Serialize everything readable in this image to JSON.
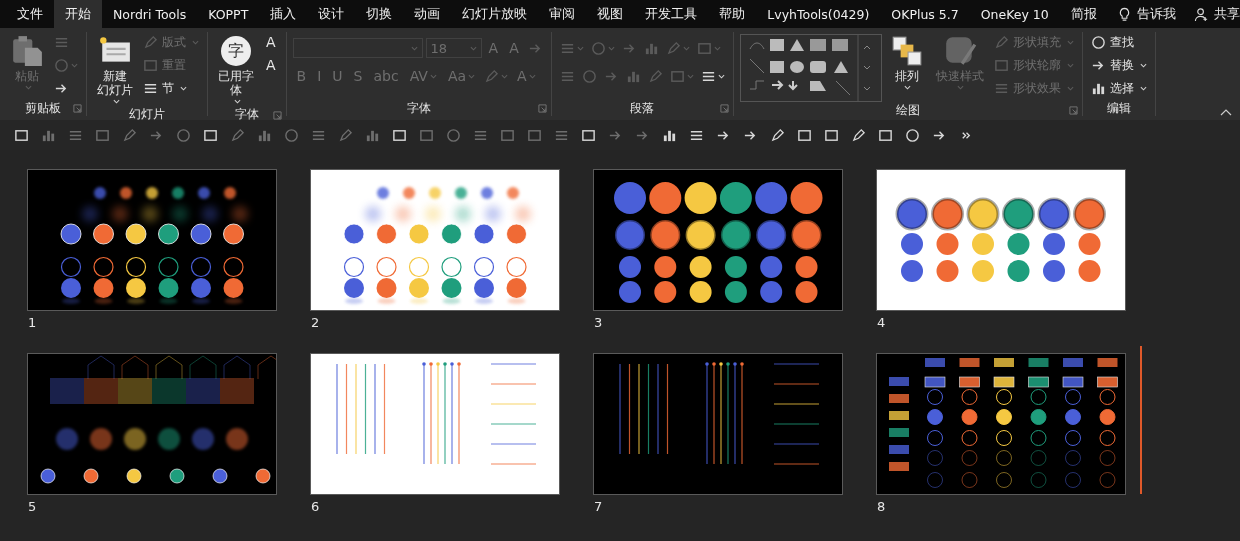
{
  "tabs": [
    {
      "label": "文件",
      "selected": false
    },
    {
      "label": "开始",
      "selected": true
    },
    {
      "label": "Nordri Tools",
      "selected": false
    },
    {
      "label": "KOPPT",
      "selected": false
    },
    {
      "label": "插入",
      "selected": false
    },
    {
      "label": "设计",
      "selected": false
    },
    {
      "label": "切换",
      "selected": false
    },
    {
      "label": "动画",
      "selected": false
    },
    {
      "label": "幻灯片放映",
      "selected": false
    },
    {
      "label": "审阅",
      "selected": false
    },
    {
      "label": "视图",
      "selected": false
    },
    {
      "label": "开发工具",
      "selected": false
    },
    {
      "label": "帮助",
      "selected": false
    },
    {
      "label": "LvyhTools(0429)",
      "selected": false
    },
    {
      "label": "OKPlus 5.7",
      "selected": false
    },
    {
      "label": "OneKey 10",
      "selected": false
    },
    {
      "label": "简报",
      "selected": false
    }
  ],
  "tell_me": "告诉我",
  "share": "共享",
  "ribbon_groups": [
    {
      "label": "剪贴板",
      "launcher": true,
      "kind": "columns",
      "columns": [
        [
          {
            "kind": "paste",
            "label": [
              "粘贴"
            ],
            "disabled": true,
            "dropdown": true
          }
        ],
        [
          {
            "kind": "icon",
            "disabled": true,
            "dropdown": false
          },
          {
            "kind": "icon",
            "disabled": true,
            "dropdown": true
          },
          {
            "kind": "icon",
            "disabled": false,
            "dropdown": false
          }
        ]
      ]
    },
    {
      "label": "幻灯片",
      "launcher": false,
      "kind": "columns",
      "columns": [
        [
          {
            "kind": "new-slide",
            "label": [
              "新建",
              "幻灯片"
            ],
            "disabled": false,
            "dropdown": true
          }
        ],
        [
          {
            "kind": "small",
            "label": "版式",
            "disabled": true,
            "dropdown": true
          },
          {
            "kind": "small",
            "label": "重置",
            "disabled": true,
            "dropdown": false
          },
          {
            "kind": "small",
            "label": "节",
            "disabled": false,
            "dropdown": true
          }
        ]
      ]
    },
    {
      "label": "字体",
      "launcher": true,
      "kind": "columns",
      "columns": [
        [
          {
            "kind": "fonts",
            "label": [
              "已用字",
              "体"
            ],
            "badge": "字",
            "disabled": false,
            "dropdown": true
          }
        ],
        [
          {
            "kind": "glyph",
            "label": "A",
            "disabled": false,
            "dropdown": false
          },
          {
            "kind": "glyph",
            "label": "A",
            "disabled": false,
            "dropdown": false
          }
        ]
      ]
    },
    {
      "label": "字体",
      "launcher": true,
      "kind": "rows",
      "columns": [
        [
          {
            "kind": "field",
            "disabled": true,
            "dropdown": true
          },
          {
            "kind": "field",
            "value": "18",
            "disabled": true,
            "dropdown": true
          },
          {
            "kind": "glyph",
            "label": "A",
            "disabled": true,
            "dropdown": false
          },
          {
            "kind": "glyph",
            "label": "A",
            "disabled": true,
            "dropdown": false
          },
          {
            "kind": "icon",
            "disabled": true,
            "dropdown": false
          }
        ],
        [
          {
            "kind": "glyph",
            "label": "B",
            "disabled": true,
            "dropdown": false
          },
          {
            "kind": "glyph",
            "label": "I",
            "disabled": true,
            "dropdown": false
          },
          {
            "kind": "glyph",
            "label": "U",
            "disabled": true,
            "dropdown": false
          },
          {
            "kind": "glyph",
            "label": "S",
            "disabled": true,
            "dropdown": false
          },
          {
            "kind": "glyph",
            "label": "abc",
            "disabled": true,
            "dropdown": false
          },
          {
            "kind": "glyph",
            "label": "AV",
            "disabled": true,
            "dropdown": true
          },
          {
            "kind": "glyph",
            "label": "Aa",
            "disabled": true,
            "dropdown": true
          },
          {
            "kind": "icon",
            "disabled": true,
            "dropdown": true
          },
          {
            "kind": "glyph",
            "label": "A",
            "disabled": true,
            "dropdown": true
          }
        ]
      ]
    },
    {
      "label": "段落",
      "launcher": true,
      "kind": "rows",
      "columns": [
        [
          {
            "kind": "icon",
            "disabled": true,
            "dropdown": true
          },
          {
            "kind": "icon",
            "disabled": true,
            "dropdown": true
          },
          {
            "kind": "icon",
            "disabled": true,
            "dropdown": false
          },
          {
            "kind": "icon",
            "disabled": true,
            "dropdown": false
          },
          {
            "kind": "icon",
            "disabled": true,
            "dropdown": true
          },
          {
            "kind": "icon",
            "disabled": true,
            "dropdown": true
          }
        ],
        [
          {
            "kind": "icon",
            "disabled": true,
            "dropdown": false
          },
          {
            "kind": "icon",
            "disabled": true,
            "dropdown": false
          },
          {
            "kind": "icon",
            "disabled": true,
            "dropdown": false
          },
          {
            "kind": "icon",
            "disabled": true,
            "dropdown": false
          },
          {
            "kind": "icon",
            "disabled": true,
            "dropdown": false
          },
          {
            "kind": "icon",
            "disabled": true,
            "dropdown": true
          },
          {
            "kind": "icon",
            "disabled": false,
            "dropdown": true
          }
        ]
      ]
    },
    {
      "label": "绘图",
      "launcher": true,
      "kind": "columns",
      "columns": [
        [
          {
            "kind": "gallery"
          }
        ],
        [
          {
            "kind": "arrange",
            "label": [
              "排列"
            ],
            "disabled": false,
            "dropdown": true
          }
        ],
        [
          {
            "kind": "quick-style",
            "label": [
              "快速样式"
            ],
            "disabled": true,
            "dropdown": true
          }
        ],
        [
          {
            "kind": "small",
            "label": "形状填充",
            "disabled": true,
            "dropdown": true
          },
          {
            "kind": "small",
            "label": "形状轮廓",
            "disabled": true,
            "dropdown": true
          },
          {
            "kind": "small",
            "label": "形状效果",
            "disabled": true,
            "dropdown": true
          }
        ]
      ]
    },
    {
      "label": "编辑",
      "launcher": false,
      "kind": "columns",
      "columns": [
        [
          {
            "kind": "small",
            "label": "查找",
            "disabled": false,
            "dropdown": false
          },
          {
            "kind": "small",
            "label": "替换",
            "disabled": false,
            "dropdown": true
          },
          {
            "kind": "small",
            "label": "选择",
            "disabled": false,
            "dropdown": true
          }
        ]
      ]
    }
  ],
  "slides": [
    {
      "number": "1",
      "dark": true,
      "kind": "glow-dots",
      "selected": false,
      "insertion_after": false
    },
    {
      "number": "2",
      "dark": false,
      "kind": "glow-dots",
      "selected": false,
      "insertion_after": false
    },
    {
      "number": "3",
      "dark": true,
      "kind": "glossy",
      "selected": false,
      "insertion_after": false
    },
    {
      "number": "4",
      "dark": false,
      "kind": "buttons",
      "selected": false,
      "insertion_after": false
    },
    {
      "number": "5",
      "dark": true,
      "kind": "blocks",
      "selected": false,
      "insertion_after": false
    },
    {
      "number": "6",
      "dark": false,
      "kind": "lines",
      "selected": false,
      "insertion_after": false
    },
    {
      "number": "7",
      "dark": true,
      "kind": "lines",
      "selected": false,
      "insertion_after": false
    },
    {
      "number": "8",
      "dark": true,
      "kind": "grid",
      "selected": false,
      "insertion_after": true
    }
  ]
}
